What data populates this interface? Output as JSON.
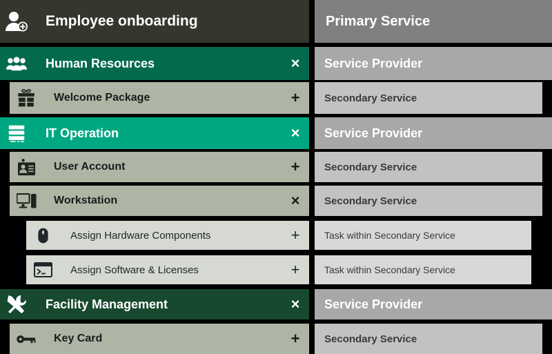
{
  "header": {
    "title": "Employee onboarding",
    "title_icon": "user-add-icon",
    "right_title": "Primary Service"
  },
  "legend": {
    "service_provider": "Service Provider",
    "secondary_service": "Secondary Service",
    "task_within_secondary_service": "Task within Secondary Service"
  },
  "colors": {
    "header_dark": "#33372D",
    "hr_green": "#046A4E",
    "it_green": "#00A881",
    "fm_green": "#17492F",
    "secondary_sage": "#AEB5A5",
    "task_light": "#D6D9D2",
    "right_primary": "#808080",
    "right_provider": "#A8A8A8",
    "right_secondary": "#C2C2C2",
    "right_task": "#D8D8D8",
    "background": "#000000"
  },
  "rows": [
    {
      "id": "human-resources",
      "label": "Human Resources",
      "icon": "group-users-icon",
      "action": "close-icon",
      "action_glyph": "×",
      "level": "provider",
      "right_label": "Service Provider",
      "right_level": "provider"
    },
    {
      "id": "welcome-package",
      "label": "Welcome Package",
      "icon": "gift-icon",
      "action": "plus-icon",
      "action_glyph": "+",
      "level": "secondary",
      "right_label": "Secondary Service",
      "right_level": "secondary"
    },
    {
      "id": "it-operation",
      "label": "IT Operation",
      "icon": "server-rack-icon",
      "action": "close-icon",
      "action_glyph": "×",
      "level": "provider",
      "right_label": "Service Provider",
      "right_level": "provider"
    },
    {
      "id": "user-account",
      "label": "User Account",
      "icon": "id-card-icon",
      "action": "plus-icon",
      "action_glyph": "+",
      "level": "secondary",
      "right_label": "Secondary Service",
      "right_level": "secondary"
    },
    {
      "id": "workstation",
      "label": "Workstation",
      "icon": "desktop-computer-icon",
      "action": "close-icon",
      "action_glyph": "×",
      "level": "secondary",
      "right_label": "Secondary Service",
      "right_level": "secondary"
    },
    {
      "id": "assign-hardware-components",
      "label": "Assign Hardware Components",
      "icon": "mouse-icon",
      "action": "plus-icon",
      "action_glyph": "+",
      "level": "task",
      "right_label": "Task within Secondary Service",
      "right_level": "task"
    },
    {
      "id": "assign-software-licenses",
      "label": "Assign Software & Licenses",
      "icon": "terminal-icon",
      "action": "plus-icon",
      "action_glyph": "+",
      "level": "task",
      "right_label": "Task within Secondary Service",
      "right_level": "task"
    },
    {
      "id": "facility-management",
      "label": "Facility Management",
      "icon": "tools-icon",
      "action": "close-icon",
      "action_glyph": "×",
      "level": "provider",
      "right_label": "Service Provider",
      "right_level": "provider"
    },
    {
      "id": "key-card",
      "label": "Key Card",
      "icon": "key-icon",
      "action": "plus-icon",
      "action_glyph": "+",
      "level": "secondary",
      "right_label": "Secondary Service",
      "right_level": "secondary"
    }
  ]
}
